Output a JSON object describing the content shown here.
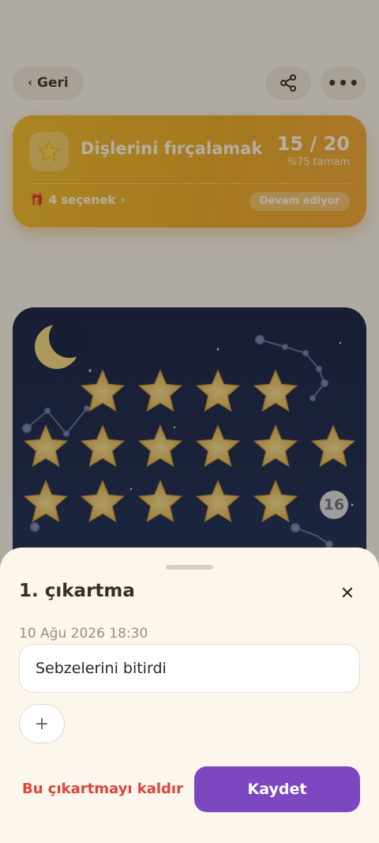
{
  "header": {
    "back_label": "Geri",
    "share_icon": "share-icon",
    "more_icon": "more-dots-icon"
  },
  "card": {
    "title": "Dişlerini fırçalamak",
    "count": "15 / 20",
    "progress_text": "%75 tamam",
    "options_label": "4 seçenek",
    "status": "Devam ediyor",
    "colors": {
      "accent": "#f1b823"
    }
  },
  "chart": {
    "filled_stars": 15,
    "next_slot_label": "16"
  },
  "sheet": {
    "title": "1. çıkartma",
    "date": "10 Ağu 2026 18:30",
    "note_value": "Sebzelerini bitirdi",
    "add_label": "+",
    "remove_label": "Bu çıkartmayı kaldır",
    "save_label": "Kaydet",
    "colors": {
      "save": "#7b48c1",
      "remove": "#d9453b"
    }
  }
}
